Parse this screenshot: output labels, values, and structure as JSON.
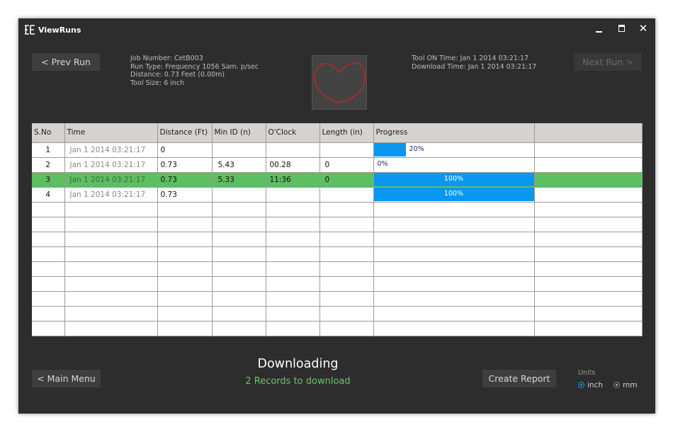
{
  "window": {
    "title": "ViewRuns",
    "close_glyph": "✕"
  },
  "nav": {
    "prev_label": "< Prev Run",
    "next_label": "Next Run >",
    "main_menu_label": "< Main Menu",
    "create_report_label": "Create Report"
  },
  "run_info": {
    "job_number": "Job Number: CetB003",
    "run_type": "Run Type: Frequency 1056 Sam. p/sec",
    "distance": "Distance: 0.73 Feet (0.00m)",
    "tool_size": "Tool Size: 6 inch",
    "tool_on_time": "Tool ON Time:  Jan 1 2014 03:21:17",
    "download_time": "Download Time: Jan 1 2014 03:21:17"
  },
  "table": {
    "headers": [
      "S.No",
      "Time",
      "Distance (Ft)",
      "Min ID (n)",
      "O'Clock",
      "Length (in)",
      "Progress",
      ""
    ],
    "rows": [
      {
        "sno": "1",
        "time": "Jan 1 2014 03:21:17",
        "distance": "0",
        "min_id": "",
        "oclock": "",
        "length": "",
        "progress": 0.2,
        "progress_label": "20%"
      },
      {
        "sno": "2",
        "time": "Jan 1 2014 03:21:17",
        "distance": "0.73",
        "min_id": "5.43",
        "oclock": "00.28",
        "length": "0",
        "progress": 0,
        "progress_label": "0%"
      },
      {
        "sno": "3",
        "time": "Jan 1 2014 03:21:17",
        "distance": "0.73",
        "min_id": "5.33",
        "oclock": "11:36",
        "length": "0",
        "progress": 1.0,
        "progress_label": "100%",
        "selected": true
      },
      {
        "sno": "4",
        "time": "Jan 1 2014 03:21:17",
        "distance": "0.73",
        "min_id": "",
        "oclock": "",
        "length": "",
        "progress": 1.0,
        "progress_label": "100%"
      }
    ],
    "empty_rows": 9
  },
  "status": {
    "title": "Downloading",
    "subtitle": "2 Records to download"
  },
  "units": {
    "label": "Units",
    "options": [
      "inch",
      "mm"
    ],
    "selected": "inch"
  },
  "colors": {
    "accent": "#0a97f0",
    "selected_row": "#5cbf61",
    "status_green": "#6bc46e",
    "thumb_curve": "#c0272d"
  },
  "icons": {
    "app": "app-logo-icon",
    "minimize": "minimize-icon",
    "maximize": "maximize-icon",
    "close": "close-icon"
  }
}
